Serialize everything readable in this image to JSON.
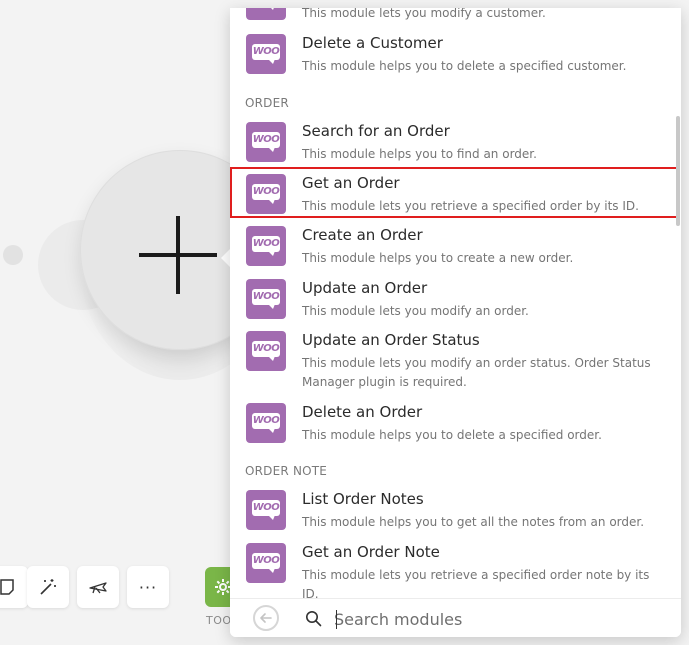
{
  "toolbar": {
    "tools_label": "TOO",
    "more_label": "···",
    "tools_color": "#7ab648"
  },
  "panel": {
    "sections": [
      {
        "header": "ORDER"
      },
      {
        "header": "ORDER NOTE"
      }
    ],
    "modules": [
      {
        "title": "",
        "desc": "This module lets you modify a customer."
      },
      {
        "title": "Delete a Customer",
        "desc": "This module helps you to delete a specified customer."
      },
      {
        "title": "Search for an Order",
        "desc": "This module helps you to find an order."
      },
      {
        "title": "Get an Order",
        "desc": "This module lets you retrieve a specified order by its ID."
      },
      {
        "title": "Create an Order",
        "desc": "This module helps you to create a new order."
      },
      {
        "title": "Update an Order",
        "desc": "This module lets you modify an order."
      },
      {
        "title": "Update an Order Status",
        "desc": "This module lets you modify an order status. Order Status Manager plugin is required."
      },
      {
        "title": "Delete an Order",
        "desc": "This module helps you to delete a specified order."
      },
      {
        "title": "List Order Notes",
        "desc": "This module helps you to get all the notes from an order."
      },
      {
        "title": "Get an Order Note",
        "desc": "This module lets you retrieve a specified order note by its ID."
      }
    ],
    "icon_label": "WOO",
    "icon_color": "#a26cb0",
    "highlight_color": "#e01e1e"
  },
  "search": {
    "placeholder": "Search modules",
    "value": ""
  }
}
